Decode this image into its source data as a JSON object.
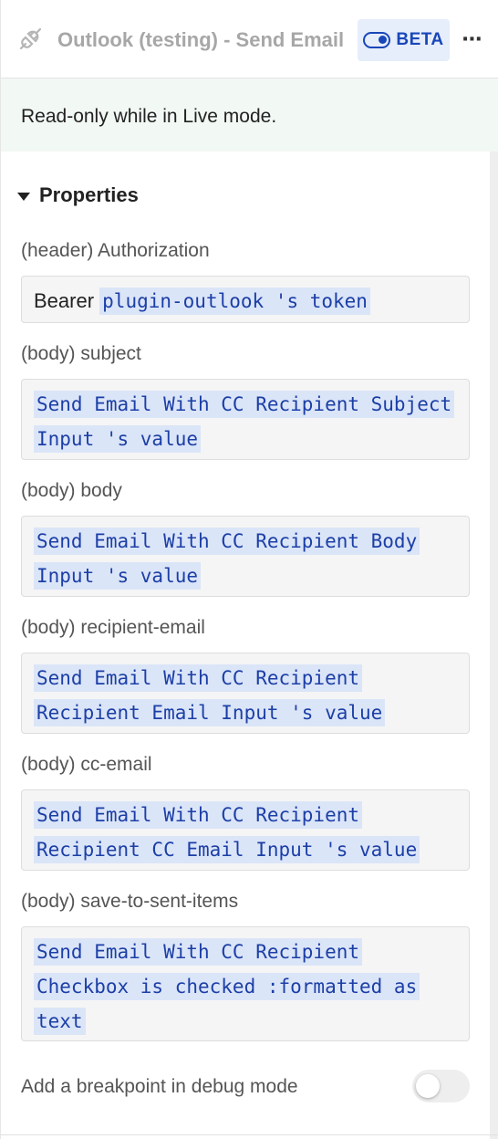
{
  "header": {
    "title": "Outlook (testing) - Send Email",
    "beta_label": "BETA",
    "more_label": "⋯",
    "plugin_icon": "plug-disconnected-icon"
  },
  "banner": {
    "text": "Read-only while in Live mode."
  },
  "properties": {
    "section_label": "Properties",
    "fields": [
      {
        "label": "(header) Authorization",
        "prefix": "Bearer ",
        "value": "plugin-outlook 's token"
      },
      {
        "label": "(body) subject",
        "value": " Send Email With CC Recipient Subject Input 's value"
      },
      {
        "label": "(body) body",
        "value": " Send Email With CC Recipient Body Input 's value"
      },
      {
        "label": "(body) recipient-email",
        "value": " Send Email With CC Recipient Recipient Email Input 's value"
      },
      {
        "label": "(body) cc-email",
        "value": " Send Email With CC Recipient Recipient CC Email Input 's value"
      },
      {
        "label": "(body) save-to-sent-items",
        "value": " Send Email With CC Recipient Checkbox  is checked :formatted as text"
      }
    ]
  },
  "debug": {
    "label": "Add a breakpoint in debug mode",
    "enabled": false
  },
  "colors": {
    "accent": "#1947b8",
    "chip_bg": "#dbe5f8",
    "chip_text": "#1c3fa6",
    "banner_bg": "#f2f8f3"
  }
}
